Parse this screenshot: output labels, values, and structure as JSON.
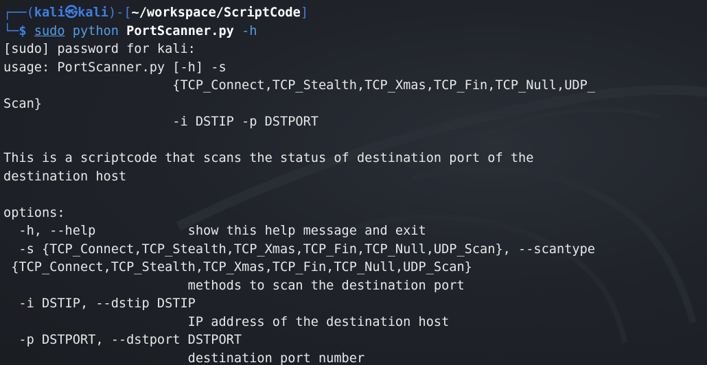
{
  "prompt": {
    "frame_open": "┌──(",
    "user": "kali",
    "at_symbol": "㉿",
    "host": "kali",
    "frame_mid": ")-[",
    "path": "~/workspace/ScriptCode",
    "frame_close": "]",
    "corner": "└─",
    "dollar": "$ "
  },
  "command": {
    "sudo": "sudo",
    "python": "python",
    "script": "PortScanner.py",
    "flag": "-h"
  },
  "output_lines": [
    "[sudo] password for kali:",
    "usage: PortScanner.py [-h] -s",
    "                      {TCP_Connect,TCP_Stealth,TCP_Xmas,TCP_Fin,TCP_Null,UDP_",
    "Scan}",
    "                      -i DSTIP -p DSTPORT",
    "",
    "This is a scriptcode that scans the status of destination port of the",
    "destination host",
    "",
    "options:",
    "  -h, --help            show this help message and exit",
    "  -s {TCP_Connect,TCP_Stealth,TCP_Xmas,TCP_Fin,TCP_Null,UDP_Scan}, --scantype",
    " {TCP_Connect,TCP_Stealth,TCP_Xmas,TCP_Fin,TCP_Null,UDP_Scan}",
    "                        methods to scan the destination port",
    "  -i DSTIP, --dstip DSTIP",
    "                        IP address of the destination host",
    "  -p DSTPORT, --dstport DSTPORT",
    "                        destination port number"
  ],
  "colors": {
    "background": "#1d2026",
    "prompt_blue": "#3f7ee8",
    "command_blue": "#4f9ee8",
    "text": "#e8e8e8"
  }
}
